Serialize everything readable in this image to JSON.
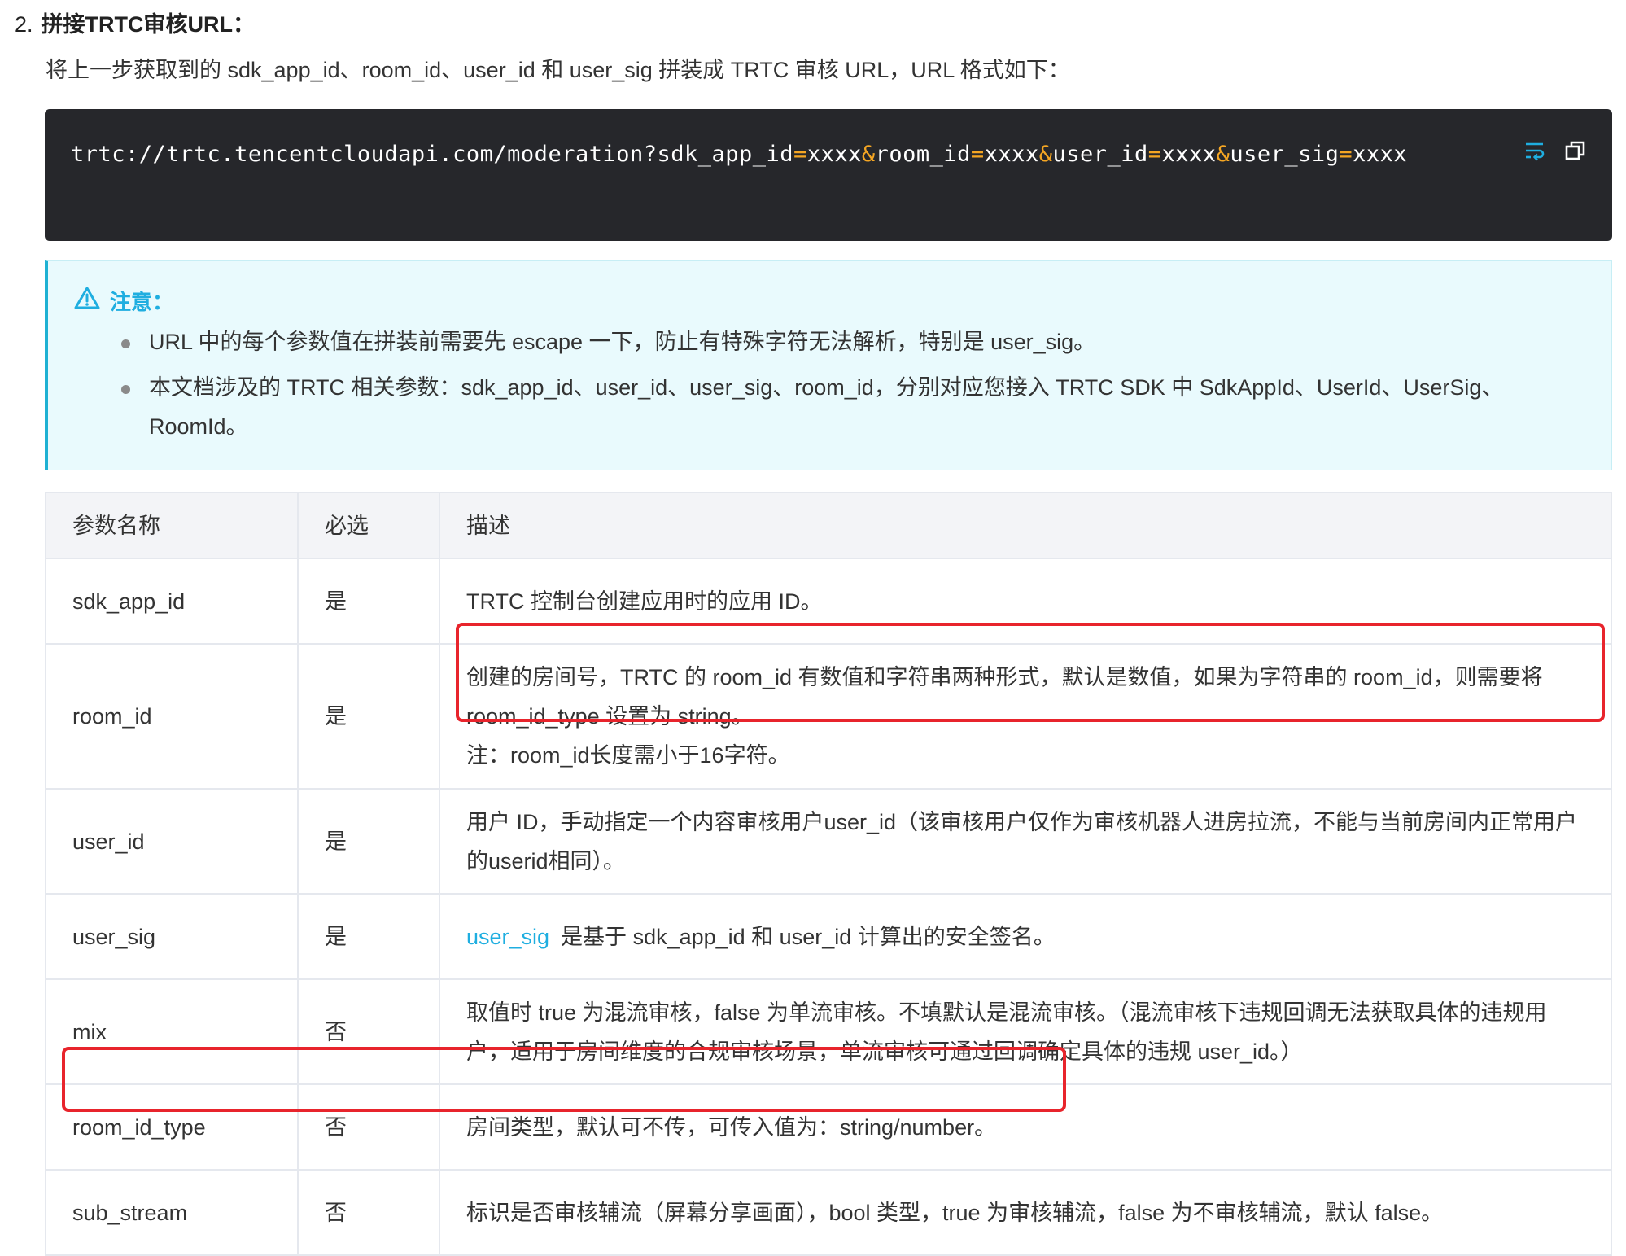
{
  "step": {
    "number": "2.",
    "title": "拼接TRTC审核URL：",
    "description": "将上一步获取到的 sdk_app_id、room_id、user_id 和 user_sig 拼装成 TRTC 审核 URL，URL 格式如下："
  },
  "code": {
    "base": "trtc://trtc.tencentcloudapi.com/moderation?",
    "params": [
      {
        "key": "sdk_app_id",
        "value": "xxxx"
      },
      {
        "key": "room_id",
        "value": "xxxx"
      },
      {
        "key": "user_id",
        "value": "xxxx"
      },
      {
        "key": "user_sig",
        "value": "xxxx"
      }
    ],
    "separator": "&",
    "equals": "=",
    "wrap_icon": "wrap-icon",
    "copy_icon": "copy-icon"
  },
  "notice": {
    "icon": "warning-icon",
    "title": "注意：",
    "items": [
      "URL 中的每个参数值在拼装前需要先 escape 一下，防止有特殊字符无法解析，特别是 user_sig。",
      "本文档涉及的 TRTC 相关参数：sdk_app_id、user_id、user_sig、room_id，分别对应您接入 TRTC SDK 中 SdkAppId、UserId、UserSig、RoomId。"
    ]
  },
  "table": {
    "headers": [
      "参数名称",
      "必选",
      "描述"
    ],
    "rows": [
      {
        "name": "sdk_app_id",
        "required": "是",
        "desc": [
          "TRTC 控制台创建应用时的应用 ID。"
        ]
      },
      {
        "name": "room_id",
        "required": "是",
        "desc": [
          "创建的房间号，TRTC 的 room_id 有数值和字符串两种形式，默认是数值，如果为字符串的 room_id，则需要将 room_id_type 设置为 string。",
          "注：room_id长度需小于16字符。"
        ]
      },
      {
        "name": "user_id",
        "required": "是",
        "desc": [
          "用户 ID，手动指定一个内容审核用户user_id（该审核用户仅作为审核机器人进房拉流，不能与当前房间内正常用户的userid相同）。"
        ]
      },
      {
        "name": "user_sig",
        "required": "是",
        "link": "user_sig",
        "desc": [
          "是基于 sdk_app_id 和 user_id 计算出的安全签名。"
        ]
      },
      {
        "name": "mix",
        "required": "否",
        "desc": [
          "取值时 true 为混流审核，false 为单流审核。不填默认是混流审核。（混流审核下违规回调无法获取具体的违规用户，适用于房间维度的合规审核场景，单流审核可通过回调确定具体的违规 user_id。）"
        ]
      },
      {
        "name": "room_id_type",
        "required": "否",
        "desc": [
          "房间类型，默认可不传，可传入值为：string/number。"
        ]
      },
      {
        "name": "sub_stream",
        "required": "否",
        "desc": [
          "标识是否审核辅流（屏幕分享画面），bool 类型，true 为审核辅流，false 为不审核辅流，默认 false。"
        ]
      }
    ]
  },
  "colors": {
    "code_bg": "#26272b",
    "code_accent": "#f5a623",
    "notice_accent": "#1fb1d3",
    "link": "#1faee0",
    "highlight": "#e8242c"
  }
}
